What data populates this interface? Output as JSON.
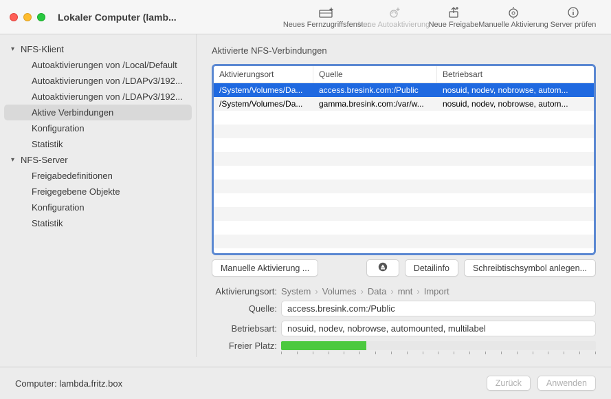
{
  "window": {
    "title": "Lokaler Computer (lamb..."
  },
  "toolbar": {
    "new_remote": "Neues Fernzugriffsfenster",
    "new_auto": "Neue Autoaktivierung",
    "new_share": "Neue Freigabe",
    "manual": "Manuelle Aktivierung",
    "check_server": "Server prüfen"
  },
  "sidebar": {
    "groups": [
      {
        "title": "NFS-Klient",
        "items": [
          "Autoaktivierungen von /Local/Default",
          "Autoaktivierungen von /LDAPv3/192...",
          "Autoaktivierungen von /LDAPv3/192...",
          "Aktive Verbindungen",
          "Konfiguration",
          "Statistik"
        ]
      },
      {
        "title": "NFS-Server",
        "items": [
          "Freigabedefinitionen",
          "Freigegebene Objekte",
          "Konfiguration",
          "Statistik"
        ]
      }
    ]
  },
  "content": {
    "title": "Aktivierte NFS-Verbindungen",
    "columns": {
      "c1": "Aktivierungsort",
      "c2": "Quelle",
      "c3": "Betriebsart"
    },
    "rows": [
      {
        "c1": "/System/Volumes/Da...",
        "c2": "access.bresink.com:/Public",
        "c3": "nosuid, nodev, nobrowse, autom..."
      },
      {
        "c1": "/System/Volumes/Da...",
        "c2": "gamma.bresink.com:/var/w...",
        "c3": "nosuid, nodev, nobrowse, autom..."
      }
    ],
    "actions": {
      "manual": "Manuelle Aktivierung ...",
      "detail": "Detailinfo",
      "desktop": "Schreibtischsymbol anlegen..."
    },
    "form": {
      "loc_label": "Aktivierungsort:",
      "breadcrumb": [
        "System",
        "Volumes",
        "Data",
        "mnt",
        "Import"
      ],
      "src_label": "Quelle:",
      "src_value": "access.bresink.com:/Public",
      "mode_label": "Betriebsart:",
      "mode_value": "nosuid, nodev, nobrowse, automounted, multilabel",
      "free_label": "Freier Platz:",
      "free_pct": 27
    }
  },
  "footer": {
    "host_label": "Computer: lambda.fritz.box",
    "back": "Zurück",
    "apply": "Anwenden"
  }
}
